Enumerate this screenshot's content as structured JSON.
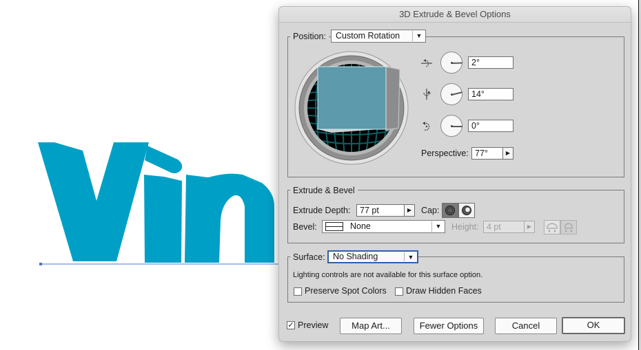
{
  "canvas": {
    "artwork_text": "Vin",
    "artwork_color": "#00a0c6",
    "selection_color": "#4a74e0"
  },
  "dialog": {
    "title": "3D Extrude & Bevel Options",
    "position": {
      "label": "Position:",
      "selected": "Custom Rotation",
      "rotation_x": "2°",
      "rotation_y": "14°",
      "rotation_z": "0°",
      "rotation_values_deg": [
        2,
        14,
        0
      ],
      "x_axis_icon": "rotate-x-axis-icon",
      "y_axis_icon": "rotate-y-axis-icon",
      "z_axis_icon": "rotate-z-axis-icon",
      "perspective_label": "Perspective:",
      "perspective_value": "77°",
      "cube_face_color": "#5c9aac",
      "cube_side_color": "#8c8c8c",
      "grid_color": "#0f5f66"
    },
    "extrude_bevel": {
      "section_label": "Extrude & Bevel",
      "depth_label": "Extrude Depth:",
      "depth_value": "77 pt",
      "cap_label": "Cap:",
      "cap_on_icon": "cap-on-icon",
      "cap_off_icon": "cap-off-icon",
      "bevel_label": "Bevel:",
      "bevel_value": "None",
      "height_label": "Height:",
      "height_value": "4 pt",
      "bevel_out_icon": "bevel-extent-out-icon",
      "bevel_in_icon": "bevel-extent-in-icon"
    },
    "surface": {
      "label": "Surface:",
      "selected": "No Shading",
      "message": "Lighting controls are not available for this surface option.",
      "preserve_spot_colors_label": "Preserve Spot Colors",
      "preserve_spot_colors_checked": false,
      "draw_hidden_faces_label": "Draw Hidden Faces",
      "draw_hidden_faces_checked": false
    },
    "footer": {
      "preview_label": "Preview",
      "preview_checked": true,
      "preview_check_glyph": "✓",
      "map_art_label": "Map Art...",
      "fewer_options_label": "Fewer Options",
      "cancel_label": "Cancel",
      "ok_label": "OK"
    },
    "glyphs": {
      "dropdown_arrow": "▼",
      "step_arrow": "▶"
    }
  }
}
